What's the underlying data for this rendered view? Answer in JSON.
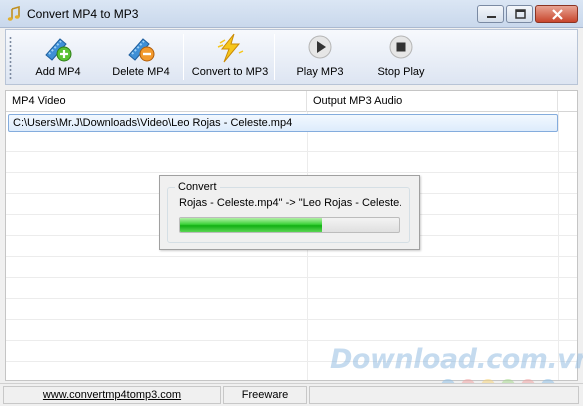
{
  "window": {
    "title": "Convert MP4 to MP3",
    "icon": "music-note-icon"
  },
  "toolbar": {
    "buttons": [
      {
        "label": "Add MP4",
        "icon": "film-add-icon"
      },
      {
        "label": "Delete MP4",
        "icon": "film-delete-icon"
      },
      {
        "label": "Convert to MP3",
        "icon": "lightning-icon"
      },
      {
        "label": "Play MP3",
        "icon": "play-icon"
      },
      {
        "label": "Stop Play",
        "icon": "stop-icon"
      }
    ]
  },
  "list": {
    "columns": [
      "MP4 Video",
      "Output MP3 Audio"
    ],
    "rows": [
      {
        "mp4_video": "C:\\Users\\Mr.J\\Downloads\\Video\\Leo Rojas - Celeste.mp4",
        "output_mp3": ""
      }
    ]
  },
  "dialog": {
    "group_title": "Convert",
    "message": "Rojas - Celeste.mp4\" -> \"Leo Rojas - Celeste.",
    "progress_fraction": 0.65
  },
  "statusbar": {
    "url": "www.convertmp4tomp3.com",
    "license": "Freeware"
  },
  "watermark": {
    "text": "Download.com.vn",
    "dot_colors": [
      "#8fbfe6",
      "#f0a4a4",
      "#f5d37c",
      "#a8d98f",
      "#f0a4a4",
      "#8fbfe6"
    ]
  },
  "colors": {
    "progress_green": "#12b014",
    "selection_border": "#84acdd"
  }
}
